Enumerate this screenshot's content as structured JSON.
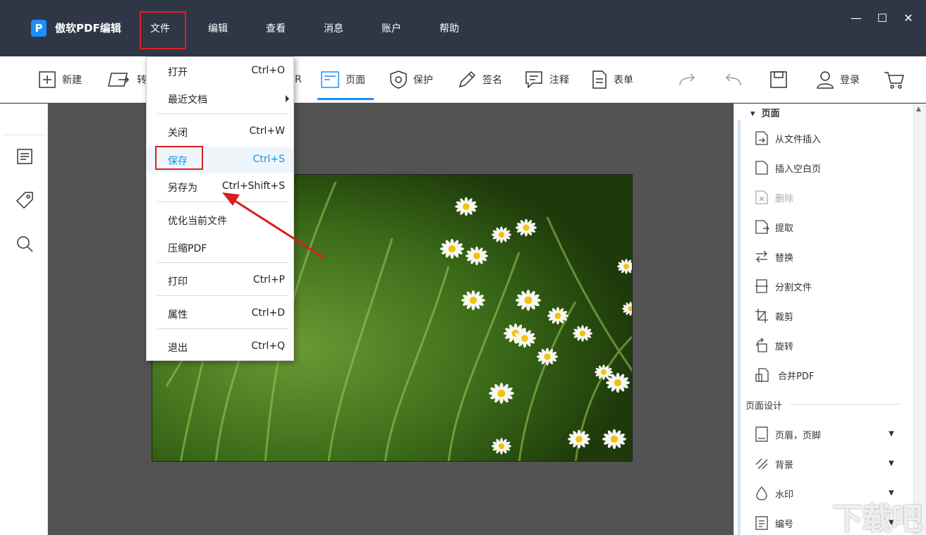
{
  "window": {
    "app_name": "傲软PDF编辑",
    "logo_letter": "P",
    "controls": {
      "minimize": "—",
      "maximize": "☐",
      "close": "✕"
    }
  },
  "menubar": {
    "items": [
      {
        "label": "文件",
        "active": true
      },
      {
        "label": "编辑"
      },
      {
        "label": "查看"
      },
      {
        "label": "消息"
      },
      {
        "label": "账户"
      },
      {
        "label": "帮助"
      }
    ]
  },
  "toolbar": {
    "new_label": "新建",
    "convert_label": "转",
    "ocr_label": "R",
    "page_label": "页面",
    "protect_label": "保护",
    "sign_label": "签名",
    "comment_label": "注释",
    "form_label": "表单",
    "login_label": "登录"
  },
  "file_menu": {
    "items": [
      {
        "label": "打开",
        "shortcut": "Ctrl+O"
      },
      {
        "label": "最近文档",
        "shortcut": "",
        "submenu": true
      },
      {
        "label": "关闭",
        "shortcut": "Ctrl+W"
      },
      {
        "label": "保存",
        "shortcut": "Ctrl+S",
        "highlighted": true
      },
      {
        "label": "另存为",
        "shortcut": "Ctrl+Shift+S"
      },
      {
        "label": "优化当前文件",
        "shortcut": ""
      },
      {
        "label": "压缩PDF",
        "shortcut": ""
      },
      {
        "label": "打印",
        "shortcut": "Ctrl+P"
      },
      {
        "label": "属性",
        "shortcut": "Ctrl+D"
      },
      {
        "label": "退出",
        "shortcut": "Ctrl+Q"
      }
    ]
  },
  "right_panel": {
    "header": "页面",
    "items": [
      {
        "label": "从文件插入",
        "icon": "insert-file-icon"
      },
      {
        "label": "插入空白页",
        "icon": "blank-page-icon"
      },
      {
        "label": "删除",
        "icon": "delete-page-icon",
        "disabled": true
      },
      {
        "label": "提取",
        "icon": "extract-icon"
      },
      {
        "label": "替换",
        "icon": "replace-icon"
      },
      {
        "label": "分割文件",
        "icon": "split-icon"
      },
      {
        "label": "裁剪",
        "icon": "crop-icon"
      },
      {
        "label": "旋转",
        "icon": "rotate-icon"
      },
      {
        "label": "合并PDF",
        "icon": "merge-icon"
      }
    ],
    "design_section": "页面设计",
    "design_items": [
      {
        "label": "页眉，页脚",
        "icon": "header-footer-icon"
      },
      {
        "label": "背景",
        "icon": "background-icon"
      },
      {
        "label": "水印",
        "icon": "watermark-icon"
      },
      {
        "label": "编号",
        "icon": "numbering-icon"
      }
    ]
  },
  "watermark_text": "下载吧",
  "colors": {
    "titlebar": "#2f3747",
    "accent": "#1890ff",
    "highlight_box": "#e02020",
    "menu_hover_text": "#1296db"
  }
}
